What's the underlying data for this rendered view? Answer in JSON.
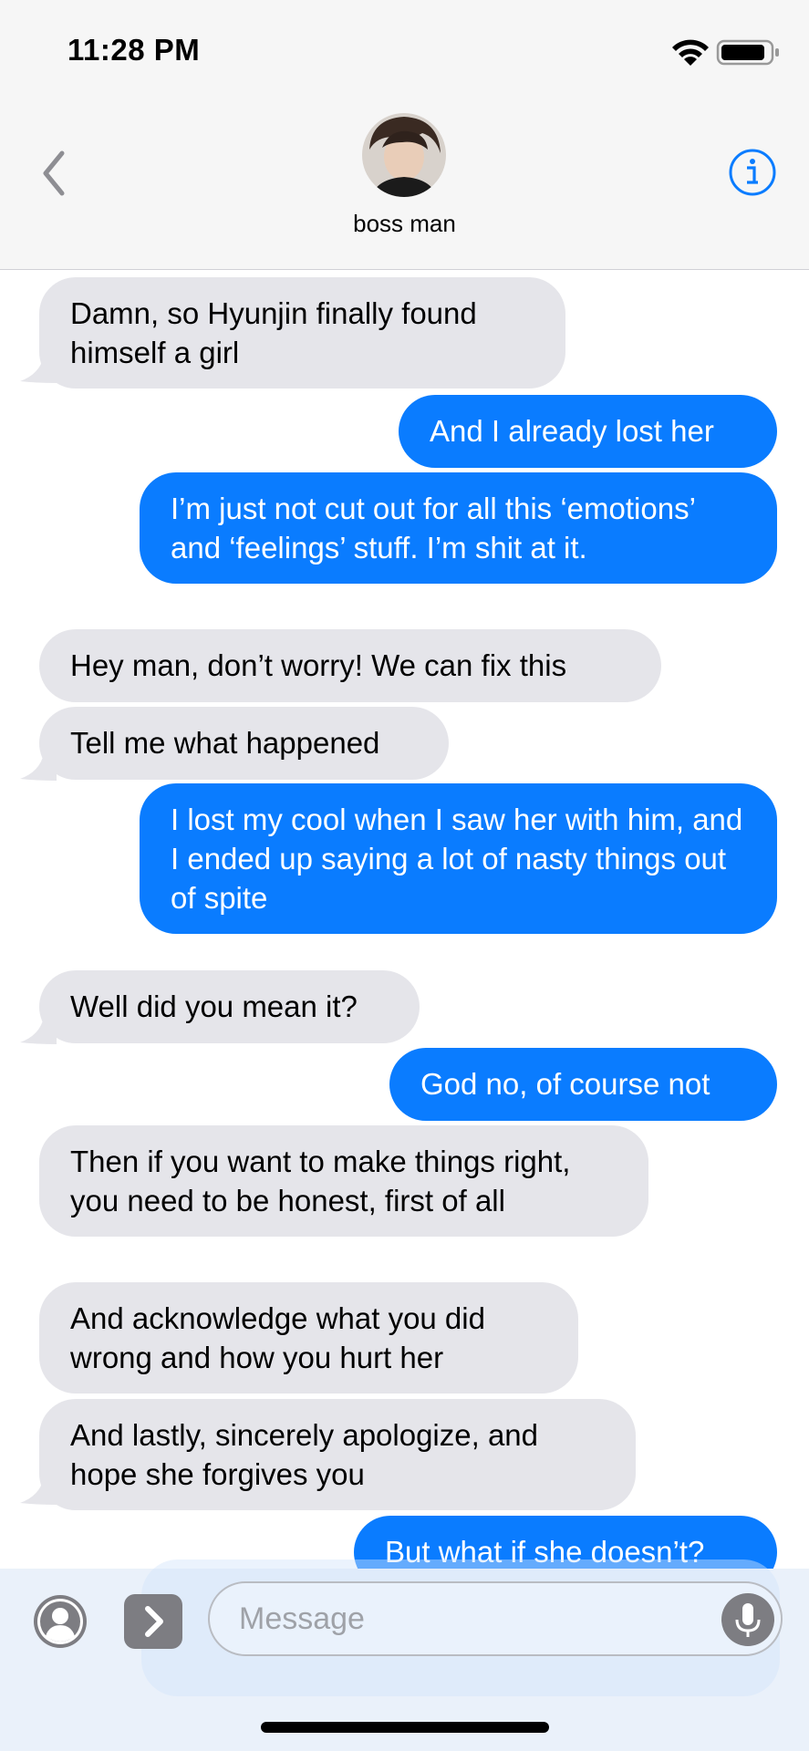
{
  "status_bar": {
    "time": "11:28 PM"
  },
  "header": {
    "contact_name": "boss man"
  },
  "messages": [
    {
      "side": "in",
      "text": "Damn, so Hyunjin finally found himself a girl"
    },
    {
      "side": "out",
      "text": "And I already lost her"
    },
    {
      "side": "out",
      "text": "I’m just not cut out for all this ‘emotions’ and ‘feelings’ stuff. I’m shit at it."
    },
    {
      "side": "in",
      "text": "Hey man, don’t worry! We can fix this"
    },
    {
      "side": "in",
      "text": "Tell me what happened"
    },
    {
      "side": "out",
      "text": "I lost my cool when I saw her with him, and I ended up saying a lot of nasty things out of spite"
    },
    {
      "side": "in",
      "text": "Well did you mean it?"
    },
    {
      "side": "out",
      "text": "God no, of course not"
    },
    {
      "side": "in",
      "text": "Then if you want to make things right, you need to be honest, first of all"
    },
    {
      "side": "in",
      "text": "And acknowledge what you did wrong and how you hurt her"
    },
    {
      "side": "in",
      "text": "And lastly, sincerely apologize, and hope she forgives you"
    },
    {
      "side": "out",
      "text": "But what if she doesn’t?"
    }
  ],
  "input": {
    "placeholder": "Message"
  },
  "colors": {
    "outgoing": "#0a7cff",
    "incoming": "#e5e5ea",
    "accent": "#0a7cff"
  }
}
